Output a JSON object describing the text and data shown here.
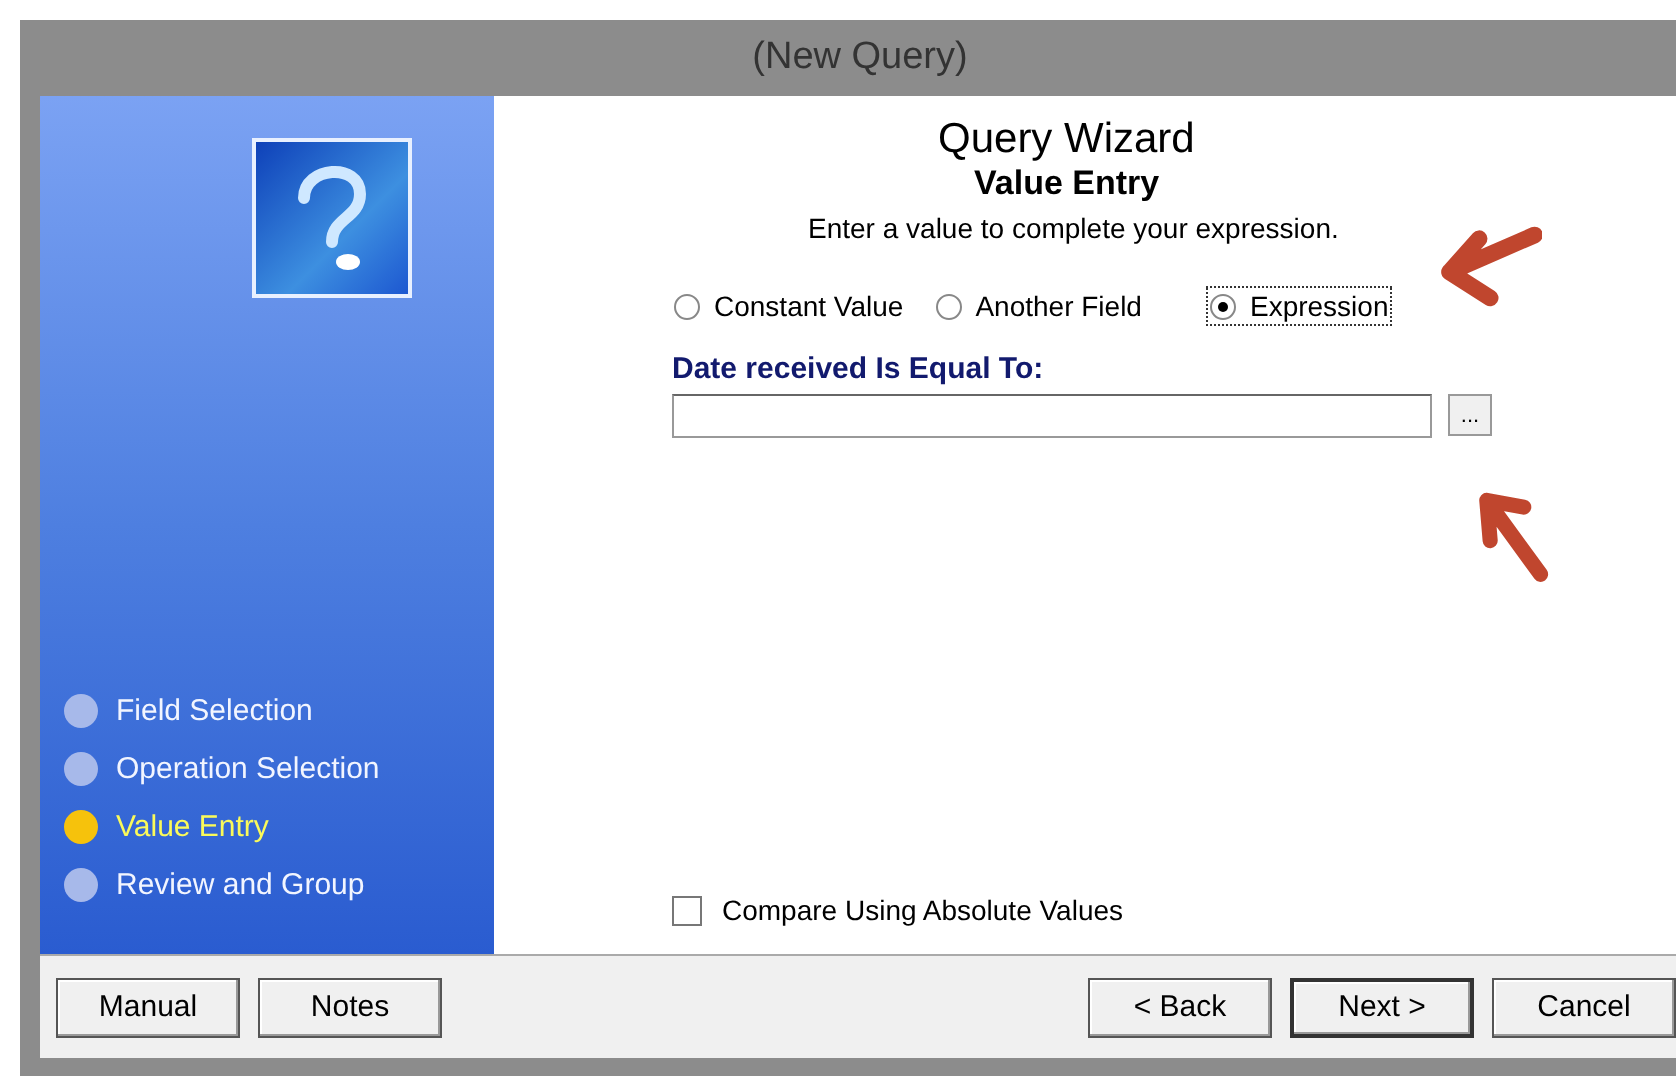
{
  "window": {
    "title": "(New Query)"
  },
  "sidebar": {
    "steps": [
      {
        "label": "Field Selection",
        "selected": false
      },
      {
        "label": "Operation Selection",
        "selected": false
      },
      {
        "label": "Value Entry",
        "selected": true
      },
      {
        "label": "Review and Group",
        "selected": false
      }
    ]
  },
  "header": {
    "title": "Query Wizard",
    "subtitle": "Value Entry",
    "instruction": "Enter a value to complete your expression."
  },
  "value_types": [
    {
      "label": "Constant Value",
      "selected": false
    },
    {
      "label": "Another Field",
      "selected": false
    },
    {
      "label": "Expression",
      "selected": true
    }
  ],
  "value_field": {
    "label": "Date received Is Equal To:",
    "browse": "..."
  },
  "absolute_values": {
    "label": "Compare Using Absolute Values",
    "checked": false
  },
  "buttons_left": [
    "Manual",
    "Notes"
  ],
  "buttons_right": [
    {
      "label": "< Back",
      "default": false
    },
    {
      "label": "Next >",
      "default": true
    },
    {
      "label": "Cancel",
      "default": false
    }
  ]
}
